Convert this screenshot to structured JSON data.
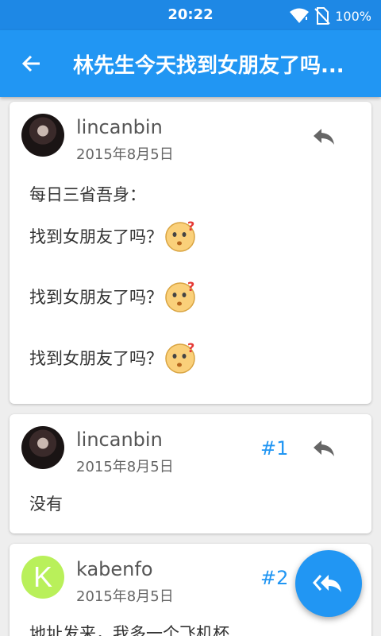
{
  "status_bar": {
    "time": "20:22",
    "battery": "100%"
  },
  "app_bar": {
    "title": "林先生今天找到女朋友了吗..."
  },
  "posts": [
    {
      "username": "lincanbin",
      "date": "2015年8月5日",
      "body_lines": [
        "每日三省吾身：",
        "找到女朋友了吗？",
        "找到女朋友了吗？",
        "找到女朋友了吗？"
      ]
    },
    {
      "username": "lincanbin",
      "date": "2015年8月5日",
      "floor": "#1",
      "body": "没有"
    },
    {
      "username": "kabenfo",
      "avatar_letter": "K",
      "date": "2015年8月5日",
      "floor": "#2",
      "body": "地址发来，我多一个飞机杯"
    }
  ],
  "colors": {
    "primary": "#2196F3",
    "status": "#1E88E5",
    "avatar_k": "#B9F05A"
  },
  "icons": [
    "wifi-icon",
    "no-sim-icon",
    "back-arrow-icon",
    "reply-icon",
    "confused-emoji-icon",
    "reply-all-icon"
  ]
}
